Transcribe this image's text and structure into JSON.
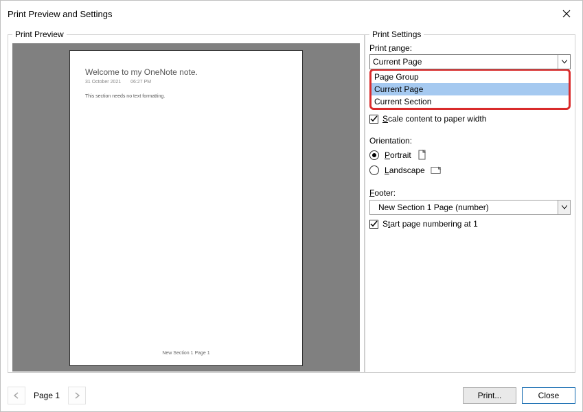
{
  "window": {
    "title": "Print Preview and Settings"
  },
  "preview": {
    "legend": "Print Preview",
    "page_title": "Welcome to my OneNote note.",
    "page_date": "31 October 2021",
    "page_time": "06:27 PM",
    "page_body": "This section needs no text formatting.",
    "page_footer": "New Section 1 Page 1"
  },
  "settings": {
    "legend": "Print Settings",
    "range_label": "Print range:",
    "range_value": "Current Page",
    "range_options": [
      "Page Group",
      "Current Page",
      "Current Section"
    ],
    "scale_label": "Scale content to paper width",
    "scale_checked": true,
    "orientation_label": "Orientation:",
    "portrait_label": "Portrait",
    "landscape_label": "Landscape",
    "orientation_value": "Portrait",
    "footer_label": "Footer:",
    "footer_value": "New Section 1 Page (number)",
    "start_num_label": "Start page numbering at 1",
    "start_num_checked": true
  },
  "nav": {
    "page_indicator": "Page 1"
  },
  "buttons": {
    "print": "Print...",
    "close": "Close"
  }
}
